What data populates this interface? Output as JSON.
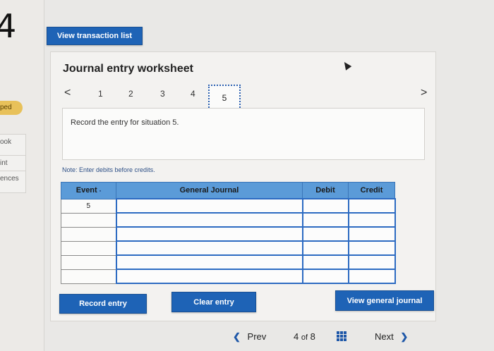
{
  "rail": {
    "number": "4",
    "badge": "ped",
    "items": [
      "ook",
      "int",
      "ences"
    ]
  },
  "toolbar": {
    "view_transaction_list": "View transaction list"
  },
  "worksheet": {
    "title": "Journal entry worksheet",
    "steps": [
      "1",
      "2",
      "3",
      "4",
      "5"
    ],
    "active_step": "5",
    "prev_arrow": "<",
    "next_arrow": ">",
    "instruction": "Record the entry for situation 5.",
    "note": "Note: Enter debits before credits."
  },
  "table": {
    "headers": [
      "Event",
      "General Journal",
      "Debit",
      "Credit"
    ],
    "event_marker": "▪",
    "rows": [
      [
        "5",
        "",
        "",
        ""
      ],
      [
        "",
        "",
        "",
        ""
      ],
      [
        "",
        "",
        "",
        ""
      ],
      [
        "",
        "",
        "",
        ""
      ],
      [
        "",
        "",
        "",
        ""
      ],
      [
        "",
        "",
        "",
        ""
      ]
    ]
  },
  "actions": {
    "record_entry": "Record entry",
    "clear_entry": "Clear entry",
    "view_general_journal": "View general journal"
  },
  "pager": {
    "prev": "Prev",
    "current": "4",
    "of": "of",
    "total": "8",
    "next": "Next"
  },
  "colors": {
    "accent": "#1e63b6",
    "header": "#5b9bd8",
    "badge": "#e8c15a"
  }
}
